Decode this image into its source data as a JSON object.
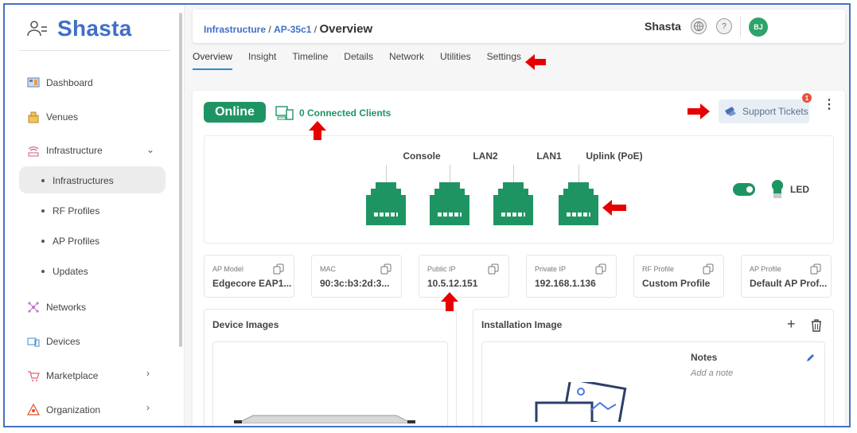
{
  "app": {
    "name": "Shasta"
  },
  "sidebar": {
    "items": [
      {
        "label": "Dashboard",
        "icon": "dashboard-icon"
      },
      {
        "label": "Venues",
        "icon": "venues-icon"
      },
      {
        "label": "Infrastructure",
        "icon": "infrastructure-icon"
      },
      {
        "label": "Networks",
        "icon": "networks-icon"
      },
      {
        "label": "Devices",
        "icon": "devices-icon"
      },
      {
        "label": "Marketplace",
        "icon": "marketplace-icon"
      },
      {
        "label": "Organization",
        "icon": "organization-icon"
      }
    ],
    "sub_items": [
      "Infrastructures",
      "RF Profiles",
      "AP Profiles",
      "Updates"
    ],
    "active_sub": "Infrastructures"
  },
  "header": {
    "breadcrumb": [
      "Infrastructure",
      "AP-35c1"
    ],
    "breadcrumb_sep": "/",
    "current": "Overview",
    "tenant": "Shasta",
    "avatar_initials": "BJ"
  },
  "tabs": [
    "Overview",
    "Insight",
    "Timeline",
    "Details",
    "Network",
    "Utilities",
    "Settings"
  ],
  "active_tab": "Overview",
  "status": {
    "online_label": "Online",
    "clients_label": "0 Connected Clients",
    "support_label": "Support Tickets",
    "support_badge": "1"
  },
  "ports": [
    "Console",
    "LAN2",
    "LAN1",
    "Uplink (PoE)"
  ],
  "led_label": "LED",
  "info": [
    {
      "key": "AP Model",
      "value": "Edgecore EAP1..."
    },
    {
      "key": "MAC",
      "value": "90:3c:b3:2d:3..."
    },
    {
      "key": "Public IP",
      "value": "10.5.12.151"
    },
    {
      "key": "Private IP",
      "value": "192.168.1.136"
    },
    {
      "key": "RF Profile",
      "value": "Custom Profile"
    },
    {
      "key": "AP Profile",
      "value": "Default AP Prof..."
    }
  ],
  "device_images": {
    "title": "Device Images"
  },
  "installation": {
    "title": "Installation Image",
    "notes_title": "Notes",
    "notes_placeholder": "Add a note"
  },
  "colors": {
    "brand": "#3f6fc8",
    "online": "#1f9463",
    "port_green": "#1f9463",
    "annotation_arrow": "#e60000"
  }
}
